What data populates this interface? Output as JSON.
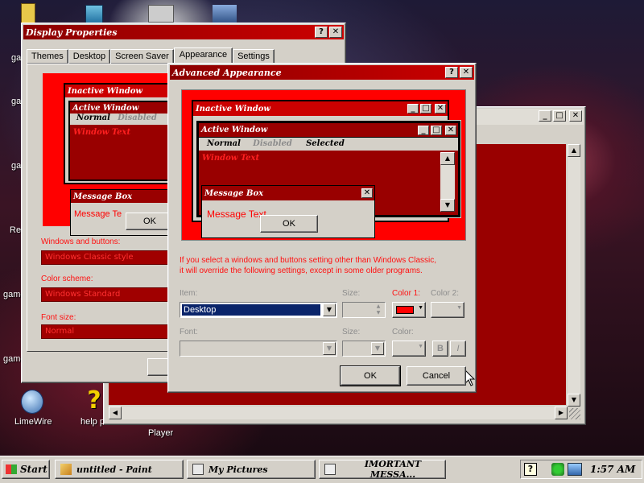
{
  "desktop": {
    "icons": [
      {
        "label": "ga",
        "name": "desktop-icon-game-1"
      },
      {
        "label": "ga",
        "name": "desktop-icon-game-2"
      },
      {
        "label": "ga",
        "name": "desktop-icon-game-3"
      },
      {
        "label": "Re",
        "name": "desktop-icon-recycle"
      },
      {
        "label": "game",
        "name": "desktop-icon-game-4"
      },
      {
        "label": "game",
        "name": "desktop-icon-game-5"
      }
    ],
    "limewire": "LimeWire",
    "help": "help p",
    "player": "Player"
  },
  "display_props": {
    "title": "Display Properties",
    "tabs": [
      "Themes",
      "Desktop",
      "Screen Saver",
      "Appearance",
      "Settings"
    ],
    "active_tab": "Appearance",
    "preview": {
      "inactive": "Inactive Window",
      "active": "Active Window",
      "normal": "Normal",
      "disabled": "Disabled",
      "window_text": "Window Text",
      "msgbox": "Message Box",
      "msg_text": "Message Te",
      "ok": "OK"
    },
    "windows_buttons_label": "Windows and buttons:",
    "windows_buttons_value": "Windows Classic style",
    "color_scheme_label": "Color scheme:",
    "color_scheme_value": "Windows Standard",
    "font_size_label": "Font size:",
    "font_size_value": "Normal"
  },
  "advanced": {
    "title": "Advanced Appearance",
    "preview": {
      "inactive": "Inactive Window",
      "active": "Active Window",
      "normal": "Normal",
      "disabled": "Disabled",
      "selected": "Selected",
      "window_text": "Window Text",
      "msgbox": "Message Box",
      "msg_text": "Message Text",
      "ok": "OK"
    },
    "info_line1": "If you select a windows and buttons setting other than Windows Classic,",
    "info_line2": "it will override the following settings, except in some older programs.",
    "item_label": "Item:",
    "item_value": "Desktop",
    "size_label": "Size:",
    "color1_label": "Color 1:",
    "color2_label": "Color 2:",
    "font_label": "Font:",
    "size2_label": "Size:",
    "color_label": "Color:",
    "bold": "B",
    "italic": "I",
    "ok": "OK",
    "cancel": "Cancel",
    "color1_hex": "#ff0000"
  },
  "taskbar": {
    "start": "Start",
    "tasks": [
      "untitled - Paint",
      "My Pictures",
      "IMORTANT MESSA..."
    ],
    "clock": "1:57 AM",
    "help_glyph": "?"
  },
  "colors": {
    "accent_red": "#ff0000",
    "dark_red": "#990000",
    "selection_blue": "#0a246a"
  }
}
